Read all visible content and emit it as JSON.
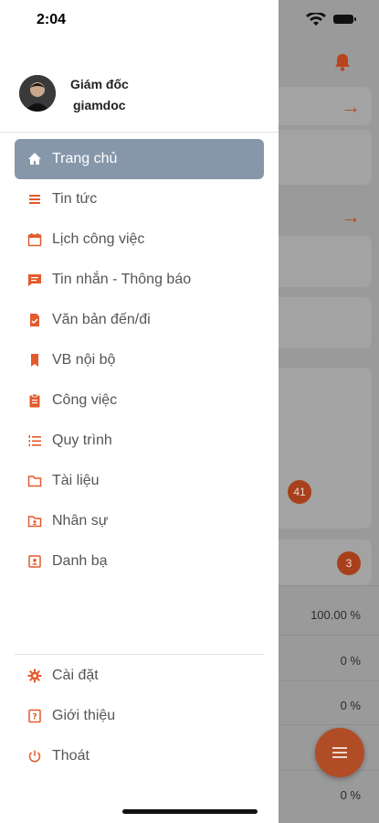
{
  "status_bar": {
    "time": "2:04"
  },
  "user": {
    "name": "Giám đốc",
    "username": "giamdoc"
  },
  "menu": [
    {
      "label": "Trang chủ",
      "icon": "home-icon",
      "active": true
    },
    {
      "label": "Tin tức",
      "icon": "list-icon"
    },
    {
      "label": "Lịch công việc",
      "icon": "calendar-icon"
    },
    {
      "label": "Tin nhắn - Thông báo",
      "icon": "message-icon"
    },
    {
      "label": "Văn bản đến/đi",
      "icon": "document-check-icon"
    },
    {
      "label": "VB nội bộ",
      "icon": "bookmark-icon"
    },
    {
      "label": "Công việc",
      "icon": "clipboard-icon"
    },
    {
      "label": "Quy trình",
      "icon": "ordered-list-icon"
    },
    {
      "label": "Tài liệu",
      "icon": "folder-icon"
    },
    {
      "label": "Nhân sự",
      "icon": "folder-user-icon"
    },
    {
      "label": "Danh bạ",
      "icon": "contact-icon"
    }
  ],
  "footer_menu": [
    {
      "label": "Cài đặt",
      "icon": "gear-icon"
    },
    {
      "label": "Giới thiệu",
      "icon": "help-icon"
    },
    {
      "label": "Thoát",
      "icon": "power-icon"
    }
  ],
  "background": {
    "badge_primary": "41",
    "badge_secondary": "3",
    "percentages": [
      "100.00 %",
      "0 %",
      "0 %",
      "0 %"
    ]
  },
  "colors": {
    "accent": "#e25a2b",
    "active_bg": "#8697aa"
  }
}
